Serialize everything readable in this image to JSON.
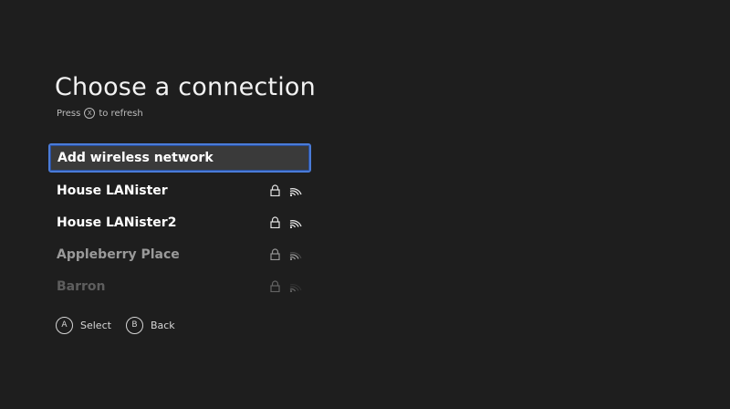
{
  "header": {
    "title": "Choose a connection",
    "hint_before": "Press",
    "hint_button": "X",
    "hint_after": "to refresh"
  },
  "networks": [
    {
      "label": "Add wireless network",
      "state": "selected",
      "secured": false
    },
    {
      "label": "House LANister",
      "state": "normal",
      "secured": true,
      "signal_icon": "wifi-signal-icon"
    },
    {
      "label": "House LANister2",
      "state": "normal",
      "secured": true,
      "signal_icon": "wifi-signal-icon"
    },
    {
      "label": "Appleberry  Place",
      "state": "dim",
      "secured": true,
      "signal_icon": "wifi-signal-icon"
    },
    {
      "label": "Barron",
      "state": "faded",
      "secured": true,
      "signal_icon": "wifi-signal-icon"
    }
  ],
  "footer": {
    "select_button": "A",
    "select_label": "Select",
    "back_button": "B",
    "back_label": "Back"
  },
  "colors": {
    "background": "#1e1e1e",
    "selection_border": "#4a7bd8",
    "selection_fill": "#3a3a3a"
  }
}
